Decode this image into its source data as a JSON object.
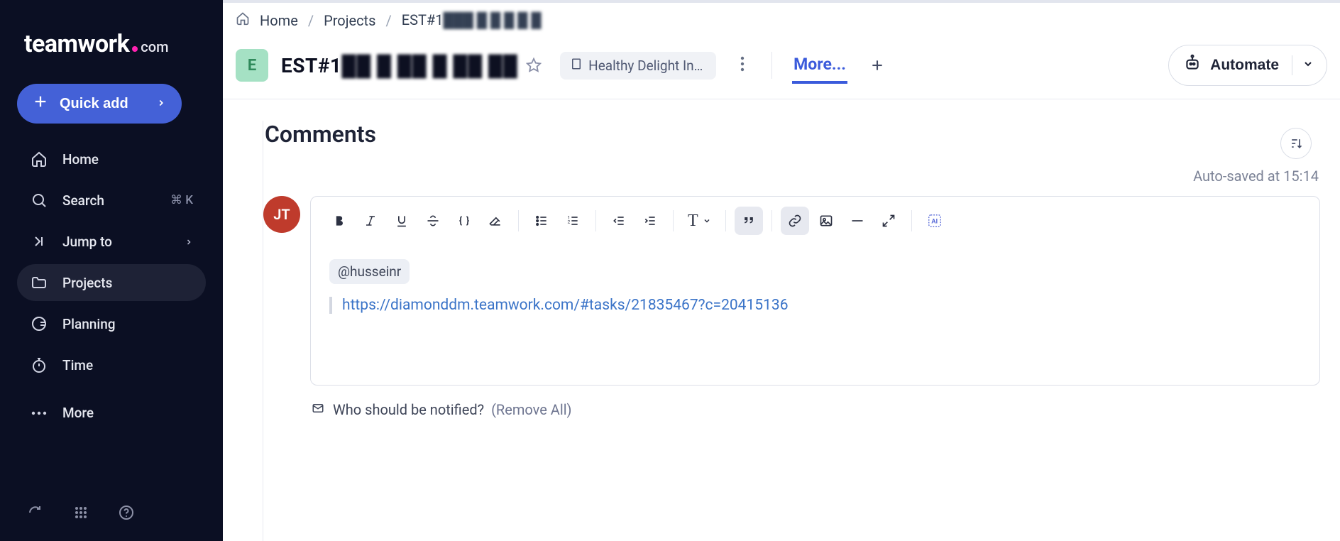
{
  "logo": {
    "main": "teamwork",
    "suffix": "com"
  },
  "quick_add_label": "Quick add",
  "nav": {
    "home": "Home",
    "search": "Search",
    "search_shortcut": "⌘ K",
    "jump_to": "Jump to",
    "projects": "Projects",
    "planning": "Planning",
    "time": "Time",
    "more": "More"
  },
  "breadcrumb": {
    "home": "Home",
    "projects": "Projects",
    "current": "EST#1",
    "current_obscured": "███ █ █ █ █ █"
  },
  "header": {
    "avatar_letter": "E",
    "title_prefix": "EST#1",
    "title_obscured": "██ █ ██ █ ██ ██",
    "tag": "Healthy Delight Inter...",
    "more_tab": "More...",
    "automate": "Automate"
  },
  "comments": {
    "title": "Comments",
    "autosaved": "Auto-saved at 15:14",
    "avatar_initials": "JT",
    "mention": "@husseinr",
    "link": "https://diamonddm.teamwork.com/#tasks/21835467?c=20415136",
    "notify_question": "Who should be notified?",
    "remove_all": "(Remove All)"
  }
}
